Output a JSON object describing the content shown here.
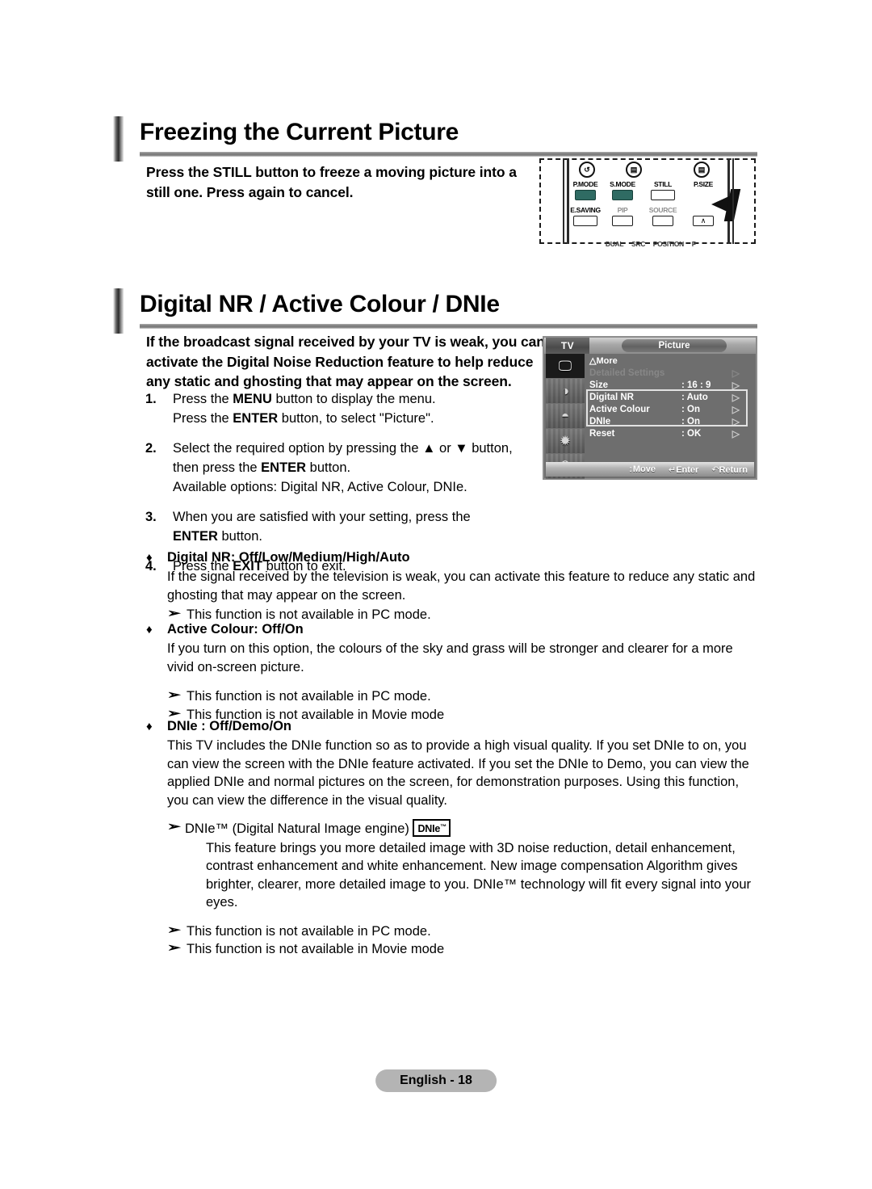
{
  "sections": [
    {
      "title": "Freezing the Current Picture",
      "intro": [
        "Press the STILL button to freeze a moving picture into a",
        "still one. Press again to cancel."
      ]
    },
    {
      "title": "Digital NR / Active Colour / DNIe",
      "intro": [
        "If the broadcast signal received by your TV is weak, you can",
        "activate the Digital Noise Reduction feature to help reduce",
        "any static and ghosting that may appear on the screen."
      ]
    }
  ],
  "steps": [
    {
      "num": "1.",
      "lines": [
        "Press the MENU button to display the menu.",
        "Press the ENTER button, to select \"Picture\"."
      ]
    },
    {
      "num": "2.",
      "lines": [
        "Select the required option by pressing the ▲ or ▼ button,",
        "then press the ENTER button.",
        "Available options: Digital NR, Active Colour, DNIe."
      ]
    },
    {
      "num": "3.",
      "lines": [
        "When you are satisfied with your setting, press the",
        "ENTER button."
      ]
    },
    {
      "num": "4.",
      "lines": [
        "Press the EXIT button to exit."
      ]
    }
  ],
  "bullets": [
    {
      "diamond": "♦",
      "heading": "Digital NR: Off/Low/Medium/High/Auto",
      "body": [
        "If the signal received by the television is weak, you can activate this feature to reduce any static and",
        "ghosting that may appear on the screen."
      ],
      "notes": [
        "This function is not available in PC mode."
      ]
    },
    {
      "diamond": "♦",
      "heading": "Active Colour: Off/On",
      "body": [
        "If you turn on this option, the colours of the sky and grass will be stronger and clearer for a more",
        "vivid on-screen picture."
      ],
      "notes": [
        "This function is not available in PC mode.",
        "This function is not available in Movie mode"
      ]
    },
    {
      "diamond": "♦",
      "heading": "DNIe : Off/Demo/On",
      "body": [
        "This TV includes the DNIe function so as to provide a high visual quality. If you set DNIe to on, you",
        "can view the screen with the DNIe feature activated. If you set the DNIe to Demo, you can view the",
        "applied DNIe and normal pictures on the screen, for demonstration purposes. Using this function,",
        "you can view the difference in the visual quality."
      ],
      "dnie_note_prefix": "DNIe™ (Digital Natural Image engine)",
      "dnie_badge": "DNIe",
      "dnie_badge_sup": "™",
      "dnie_para": [
        "This feature brings you more detailed image with 3D noise reduction, detail enhancement,",
        "contrast enhancement and white enhancement. New image compensation Algorithm gives",
        "brighter, clearer, more detailed image to you. DNIe™ technology will fit every signal into your",
        "eyes."
      ],
      "notes": [
        "This function is not available in PC mode.",
        "This function is not available in Movie mode"
      ]
    }
  ],
  "remote": {
    "top_icons": [
      "↺",
      "❑?",
      "☰"
    ],
    "row1": [
      "P.MODE",
      "S.MODE",
      "STILL",
      "P.SIZE"
    ],
    "row2": [
      "E.SAVING",
      "PIP",
      "SOURCE",
      "∧"
    ],
    "ghost_labels": [
      "DUAL",
      "SRC",
      "POSITION",
      "P"
    ]
  },
  "osd": {
    "tv_label": "TV",
    "menu_title": "Picture",
    "more_label": "△More",
    "rows": [
      {
        "label": "Detailed Settings",
        "value": "",
        "arrow": "▷",
        "dim": true
      },
      {
        "label": "Size",
        "value": ": 16 : 9",
        "arrow": "▷",
        "dim": false
      },
      {
        "label": "Digital NR",
        "value": ": Auto",
        "arrow": "▷",
        "dim": false
      },
      {
        "label": "Active Colour",
        "value": ": On",
        "arrow": "▷",
        "dim": false
      },
      {
        "label": "DNIe",
        "value": ": On",
        "arrow": "▷",
        "dim": false
      },
      {
        "label": "Reset",
        "value": ": OK",
        "arrow": "▷",
        "dim": false
      }
    ],
    "sidebar_icons": [
      "picture-icon",
      "sound-icon",
      "channel-icon",
      "setup-icon",
      "input-icon"
    ],
    "footer": [
      {
        "icon": "↕",
        "label": "Move"
      },
      {
        "icon": "↵",
        "label": "Enter"
      },
      {
        "icon": "↶",
        "label": "Return"
      }
    ]
  },
  "footer": {
    "page_label": "English - 18"
  },
  "colors": {
    "rule": "#7d7d7d",
    "osd_bg": "#6e6e6e",
    "footer_pill": "#b4b4b4"
  }
}
